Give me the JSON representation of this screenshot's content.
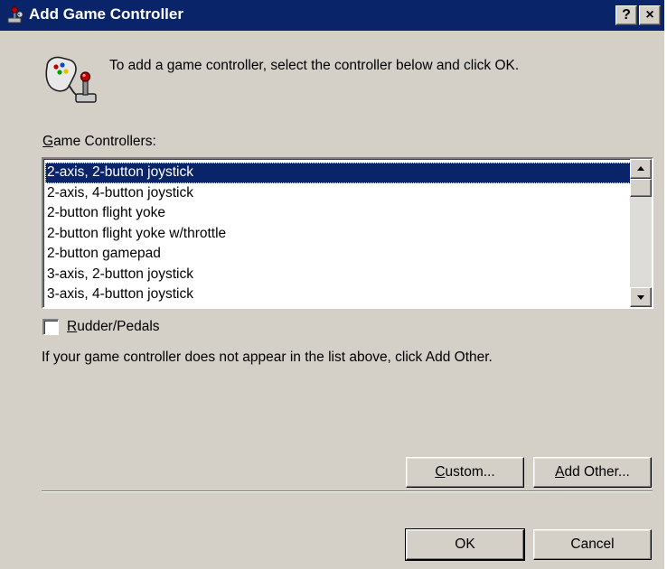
{
  "window": {
    "title": "Add Game Controller",
    "help_label": "?",
    "close_label": "×"
  },
  "instruction": "To add a game controller, select the controller below and click OK.",
  "game_controllers_label": {
    "mnemonic": "G",
    "rest": "ame Controllers:"
  },
  "controllers": [
    "2-axis, 2-button joystick",
    "2-axis, 4-button joystick",
    "2-button flight yoke",
    "2-button flight yoke w/throttle",
    "2-button gamepad",
    "3-axis, 2-button joystick",
    "3-axis, 4-button joystick"
  ],
  "selected_index": 0,
  "rudder_checkbox": {
    "mnemonic": "R",
    "rest": "udder/Pedals",
    "checked": false
  },
  "info_text": "If your game controller does not appear in the list above, click Add Other.",
  "buttons": {
    "custom": {
      "mnemonic": "C",
      "rest": "ustom..."
    },
    "add_other": {
      "mnemonic": "A",
      "rest": "dd Other..."
    },
    "ok": "OK",
    "cancel": "Cancel"
  },
  "icons": {
    "title": "joystick-icon",
    "instruction": "game-controller-icon"
  },
  "colors": {
    "titlebar": "#0a246a",
    "face": "#d4d0c8",
    "selection": "#0a246a"
  }
}
